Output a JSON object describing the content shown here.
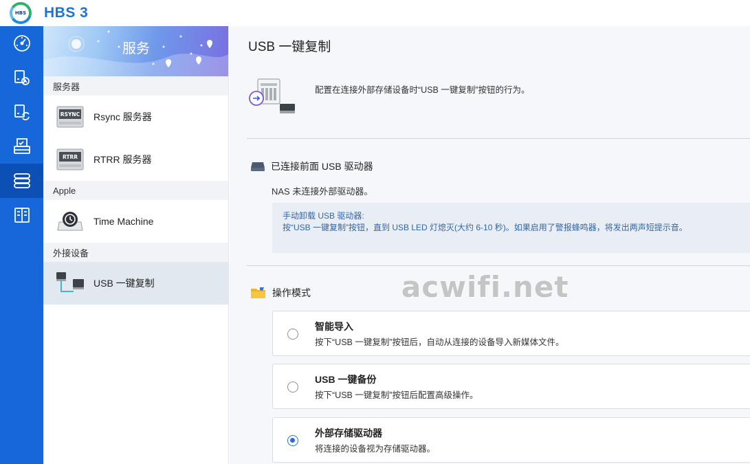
{
  "app": {
    "title": "HBS 3",
    "logo_text": "HBS"
  },
  "rail": [
    {
      "icon": "gauge-icon"
    },
    {
      "icon": "nas-restore-icon"
    },
    {
      "icon": "nas-sync-icon"
    },
    {
      "icon": "job-list-icon"
    },
    {
      "icon": "services-icon"
    },
    {
      "icon": "storage-space-icon"
    }
  ],
  "nav": {
    "banner_title": "服务",
    "sections": {
      "servers": "服务器",
      "apple": "Apple",
      "external": "外接设备"
    },
    "items": {
      "rsync": {
        "label": "Rsync 服务器",
        "icon_text": "RSYNC"
      },
      "rtrr": {
        "label": "RTRR 服务器",
        "icon_text": "RTRR"
      },
      "time_machine": {
        "label": "Time Machine"
      },
      "usb_copy": {
        "label": "USB 一键复制"
      }
    }
  },
  "main": {
    "title": "USB 一键复制",
    "description": "配置在连接外部存储设备时“USB 一键复制”按钮的行为。",
    "connected": {
      "heading": "已连接前面 USB 驱动器",
      "status": "NAS 未连接外部驱动器。",
      "info_line1": "手动卸载 USB 驱动器:",
      "info_line2": "按“USB 一键复制”按钮，直到 USB LED 灯熄灭(大约 6-10 秒)。如果启用了警报蜂鸣器，将发出两声短提示音。"
    },
    "mode": {
      "heading": "操作模式",
      "options": [
        {
          "title": "智能导入",
          "desc": "按下“USB 一键复制”按钮后，自动从连接的设备导入新媒体文件。",
          "selected": false
        },
        {
          "title": "USB 一键备份",
          "desc": "按下“USB 一键复制”按钮后配置高级操作。",
          "selected": false
        },
        {
          "title": "外部存储驱动器",
          "desc": "将连接的设备视为存储驱动器。",
          "selected": true
        }
      ]
    }
  },
  "watermark": "acwifi.net",
  "colors": {
    "accent": "#1667d9",
    "rail_active": "#0c4fb5",
    "info_text": "#3365a8"
  }
}
